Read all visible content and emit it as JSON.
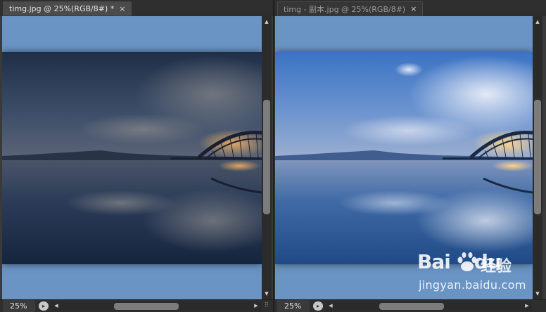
{
  "left_doc": {
    "tab_title": "timg.jpg @ 25%(RGB/8#) *",
    "close_glyph": "×",
    "zoom": "25%",
    "variant": "dark"
  },
  "right_doc": {
    "tab_title": "timg - 副本.jpg @ 25%(RGB/8#)",
    "close_glyph": "×",
    "zoom": "25%",
    "variant": "bright"
  },
  "icons": {
    "info": "status-info-icon",
    "scroll_up": "▲",
    "scroll_down": "▼",
    "scroll_left": "◀",
    "scroll_right": "▶",
    "grip": "⠿"
  },
  "colors": {
    "pasteboard": "#6a94c4",
    "ui_dark": "#2b2b2b"
  },
  "watermark": {
    "logo_text": "Bai",
    "logo_text2": "du",
    "cn_text": "经验",
    "url": "jingyan.baidu.com"
  }
}
